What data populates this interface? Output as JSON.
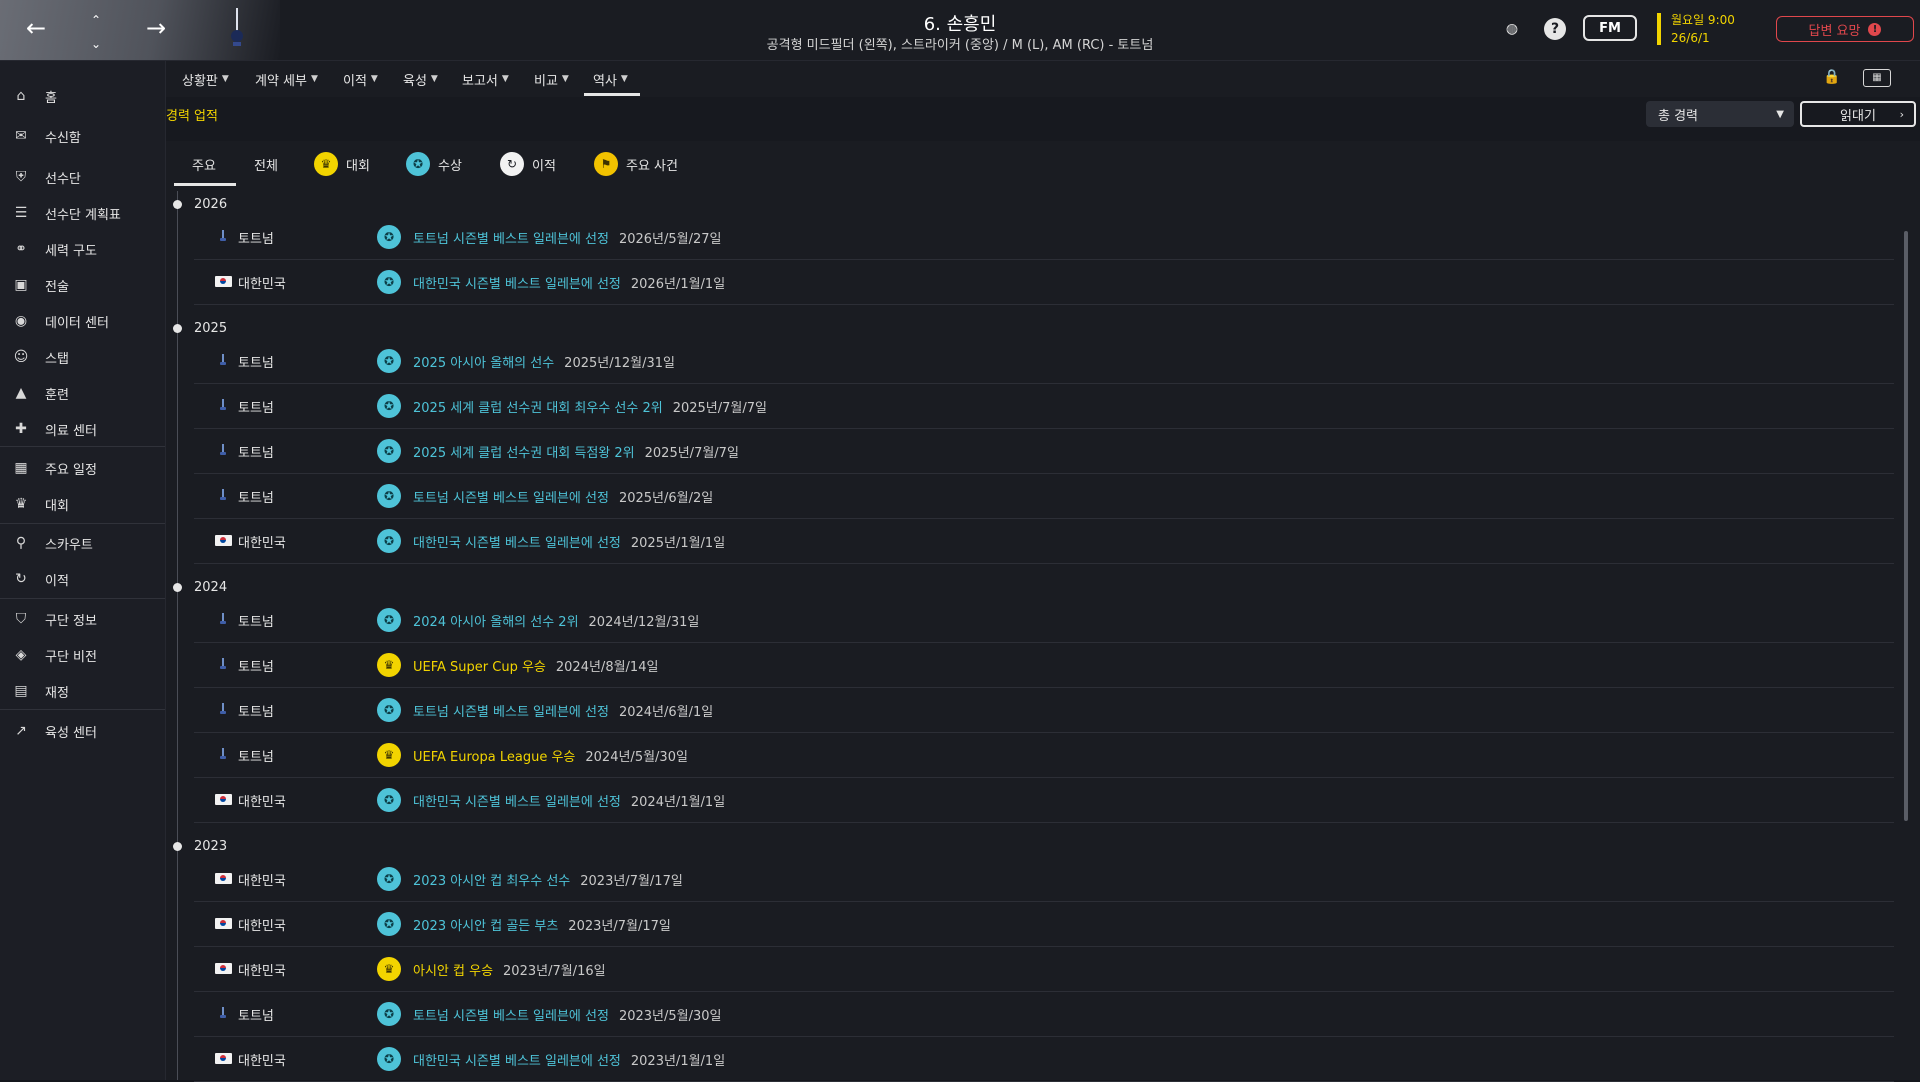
{
  "header": {
    "title": "6. 손흥민",
    "subtitle": "공격형 미드필더 (왼쪽), 스트라이커 (중앙) / M (L), AM (RC) - 토트넘",
    "fm_label": "FM",
    "date_day": "월요일 9:00",
    "date_value": "26/6/1",
    "reply_label": "답변 요망",
    "reply_badge": "!",
    "back_icon": "back-arrow-icon",
    "forward_icon": "forward-arrow-icon"
  },
  "sidebar": {
    "items": [
      {
        "label": "홈",
        "icon": "⌂"
      },
      {
        "label": "수신함",
        "icon": "✉"
      },
      {
        "label": "선수단",
        "icon": "⛨"
      },
      {
        "label": "선수단 계획표",
        "icon": "☰"
      },
      {
        "label": "세력 구도",
        "icon": "⚭"
      },
      {
        "label": "전술",
        "icon": "▣"
      },
      {
        "label": "데이터 센터",
        "icon": "◉"
      },
      {
        "label": "스탭",
        "icon": "☺"
      },
      {
        "label": "훈련",
        "icon": "▲"
      },
      {
        "label": "의료 센터",
        "icon": "✚"
      },
      {
        "label": "주요 일정",
        "icon": "▦"
      },
      {
        "label": "대회",
        "icon": "♛"
      },
      {
        "label": "스카우트",
        "icon": "⚲"
      },
      {
        "label": "이적",
        "icon": "↻"
      },
      {
        "label": "구단 정보",
        "icon": "⛉"
      },
      {
        "label": "구단 비전",
        "icon": "◈"
      },
      {
        "label": "재정",
        "icon": "▤"
      },
      {
        "label": "육성 센터",
        "icon": "↗"
      }
    ]
  },
  "topnav": {
    "items": [
      {
        "label": "상황판"
      },
      {
        "label": "계약 세부"
      },
      {
        "label": "이적"
      },
      {
        "label": "육성"
      },
      {
        "label": "보고서"
      },
      {
        "label": "비교"
      },
      {
        "label": "역사"
      }
    ],
    "active": "역사"
  },
  "content": {
    "section_title": "경력 업적",
    "filter_value": "총 경력",
    "read_label": "읽대기"
  },
  "history_tabs": [
    {
      "label": "주요"
    },
    {
      "label": "전체"
    },
    {
      "label": "대회"
    },
    {
      "label": "수상"
    },
    {
      "label": "이적"
    },
    {
      "label": "주요 사건"
    }
  ],
  "years": [
    {
      "year": "2026",
      "rows": [
        {
          "team": "토트넘",
          "kind": "award",
          "title": "토트넘 시즌별 베스트 일레븐에 선정",
          "date": "2026년/5월/27일"
        },
        {
          "team": "대한민국",
          "kind": "award",
          "title": "대한민국 시즌별 베스트 일레븐에 선정",
          "date": "2026년/1월/1일"
        }
      ]
    },
    {
      "year": "2025",
      "rows": [
        {
          "team": "토트넘",
          "kind": "award",
          "title": "2025 아시아 올해의 선수",
          "date": "2025년/12월/31일"
        },
        {
          "team": "토트넘",
          "kind": "award",
          "title": "2025 세계 클럽 선수권 대회 최우수 선수 2위",
          "date": "2025년/7월/7일"
        },
        {
          "team": "토트넘",
          "kind": "award",
          "title": "2025 세계 클럽 선수권 대회 득점왕 2위",
          "date": "2025년/7월/7일"
        },
        {
          "team": "토트넘",
          "kind": "award",
          "title": "토트넘 시즌별 베스트 일레븐에 선정",
          "date": "2025년/6월/2일"
        },
        {
          "team": "대한민국",
          "kind": "award",
          "title": "대한민국 시즌별 베스트 일레븐에 선정",
          "date": "2025년/1월/1일"
        }
      ]
    },
    {
      "year": "2024",
      "rows": [
        {
          "team": "토트넘",
          "kind": "award",
          "title": "2024 아시아 올해의 선수 2위",
          "date": "2024년/12월/31일"
        },
        {
          "team": "토트넘",
          "kind": "trophy",
          "title": "UEFA Super Cup 우승",
          "date": "2024년/8월/14일"
        },
        {
          "team": "토트넘",
          "kind": "award",
          "title": "토트넘 시즌별 베스트 일레븐에 선정",
          "date": "2024년/6월/1일"
        },
        {
          "team": "토트넘",
          "kind": "trophy",
          "title": "UEFA Europa League 우승",
          "date": "2024년/5월/30일"
        },
        {
          "team": "대한민국",
          "kind": "award",
          "title": "대한민국 시즌별 베스트 일레븐에 선정",
          "date": "2024년/1월/1일"
        }
      ]
    },
    {
      "year": "2023",
      "rows": [
        {
          "team": "대한민국",
          "kind": "award",
          "title": "2023 아시안 컵 최우수 선수",
          "date": "2023년/7월/17일"
        },
        {
          "team": "대한민국",
          "kind": "award",
          "title": "2023 아시안 컵 골든 부츠",
          "date": "2023년/7월/17일"
        },
        {
          "team": "대한민국",
          "kind": "trophy",
          "title": "아시안 컵 우승",
          "date": "2023년/7월/16일"
        },
        {
          "team": "토트넘",
          "kind": "award",
          "title": "토트넘 시즌별 베스트 일레븐에 선정",
          "date": "2023년/5월/30일"
        },
        {
          "team": "대한민국",
          "kind": "award",
          "title": "대한민국 시즌별 베스트 일레븐에 선정",
          "date": "2023년/1월/1일"
        }
      ]
    }
  ]
}
